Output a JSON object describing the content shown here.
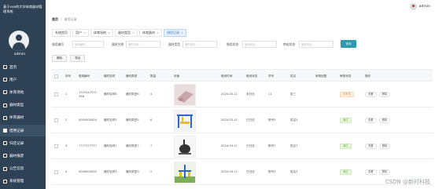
{
  "sidebar": {
    "brand": "基于vue的大学体育器材管理系统",
    "username": "admin",
    "items": [
      {
        "label": "首页",
        "icon": "home-icon"
      },
      {
        "label": "用户",
        "icon": "user-icon"
      },
      {
        "label": "体育场地",
        "icon": "field-icon"
      },
      {
        "label": "器材类型",
        "icon": "category-icon"
      },
      {
        "label": "体育器材",
        "icon": "equipment-icon"
      },
      {
        "label": "借用记录",
        "icon": "record-icon",
        "active": true
      },
      {
        "label": "归还记录",
        "icon": "return-icon"
      },
      {
        "label": "器材报废",
        "icon": "scrap-icon"
      },
      {
        "label": "公告信息",
        "icon": "notice-icon"
      },
      {
        "label": "系统管理",
        "icon": "settings-icon"
      }
    ]
  },
  "topbar": {
    "user": "admin"
  },
  "breadcrumb": {
    "home": "首页",
    "separator": "/",
    "current": "借用记录"
  },
  "tabs": [
    {
      "label": "系统首页",
      "closable": false
    },
    {
      "label": "用户",
      "closable": true
    },
    {
      "label": "体育场地",
      "closable": true
    },
    {
      "label": "器材类型",
      "closable": true
    },
    {
      "label": "体育器材",
      "closable": true
    },
    {
      "label": "借用记录",
      "closable": true,
      "active": true
    }
  ],
  "tab_close": "×",
  "filters": {
    "f1": {
      "label": "借用编号",
      "placeholder": "借用编号"
    },
    "f2": {
      "label": "器材名称",
      "placeholder": "器材名称"
    },
    "f3": {
      "label": "器材类型",
      "placeholder": "器材类型"
    },
    "f4": {
      "label": "借用状态",
      "placeholder": "借用状态"
    },
    "f5": {
      "label": "审核状态",
      "placeholder": "审核状态"
    },
    "search": "查询"
  },
  "actions": {
    "delete": "删除",
    "export": "导出"
  },
  "table": {
    "headers": [
      "",
      "序号",
      "借用编号",
      "器材名称",
      "器材类型",
      "数量",
      "封面",
      "借用时间",
      "借用状态",
      "学号",
      "姓名",
      "审核回复",
      "审核状态",
      "操作"
    ],
    "rows": [
      {
        "no": "1",
        "code": "1719147571-268",
        "name": "器材名称6",
        "type": "器材类型6",
        "qty": "4",
        "img": "mat",
        "time": "2024-03-11",
        "state": "未归还",
        "sid": "11",
        "sname": "张三",
        "reply": "",
        "audit": "未审核",
        "audit_kind": "pending"
      },
      {
        "no": "2",
        "code": "0000000000",
        "name": "器材名称5",
        "type": "器材类型5",
        "qty": "6",
        "img": "frame",
        "time": "2024-03-11",
        "state": "已归还",
        "sid": "账号5",
        "sname": "姓名5",
        "reply": "",
        "audit": "通过",
        "audit_kind": "passed"
      },
      {
        "no": "3",
        "code": "7777777777",
        "name": "器材名称7",
        "type": "器材类型7",
        "qty": "7",
        "img": "elliptical",
        "time": "2024-03-11",
        "state": "已归还",
        "sid": "账号7",
        "sname": "姓名7",
        "reply": "",
        "audit": "通过",
        "audit_kind": "passed"
      },
      {
        "no": "4",
        "code": "0000000000",
        "name": "器材名称3",
        "type": "器材类型3",
        "qty": "2",
        "img": "outdoor",
        "time": "2024-03-11",
        "state": "已归还",
        "sid": "账号3",
        "sname": "姓名3",
        "reply": "",
        "audit": "通过",
        "audit_kind": "passed"
      }
    ],
    "op_view": "查看",
    "op_delete": "删除"
  },
  "watermark": "CSDN @新时科技"
}
